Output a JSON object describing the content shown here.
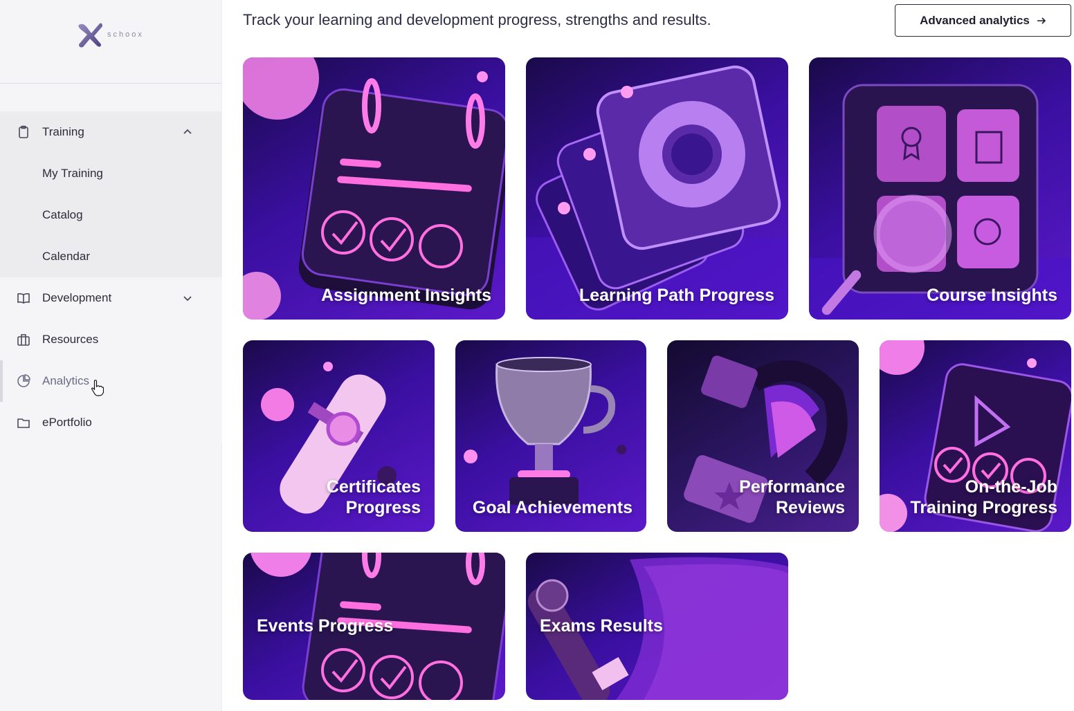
{
  "brand": {
    "logo_text": "schoox"
  },
  "header": {
    "subtitle": "Track your learning and development progress, strengths and results.",
    "advanced_button": "Advanced analytics"
  },
  "sidebar": {
    "training": {
      "label": "Training",
      "icon": "clipboard-icon",
      "children": [
        "My Training",
        "Catalog",
        "Calendar"
      ]
    },
    "items": [
      {
        "label": "Development",
        "icon": "book-icon"
      },
      {
        "label": "Resources",
        "icon": "briefcase-icon"
      },
      {
        "label": "Analytics",
        "icon": "pie-chart-icon"
      },
      {
        "label": "ePortfolio",
        "icon": "folder-icon"
      }
    ]
  },
  "tiles": [
    {
      "title": "Assignment Insights"
    },
    {
      "title": "Learning Path Progress"
    },
    {
      "title": "Course Insights"
    },
    {
      "title_line1": "Certificates",
      "title_line2": "Progress"
    },
    {
      "title": "Goal Achievements"
    },
    {
      "title_line1": "Performance",
      "title_line2": "Reviews"
    },
    {
      "title_line1": "On-the-Job",
      "title_line2": "Training Progress"
    },
    {
      "title": "Events Progress"
    },
    {
      "title": "Exams Results"
    }
  ],
  "colors": {
    "tile_dark": "#1a0a4a",
    "tile_mid": "#3a0fa0",
    "tile_light": "#5b19c9",
    "accent_pink": "#ff6fe0"
  }
}
